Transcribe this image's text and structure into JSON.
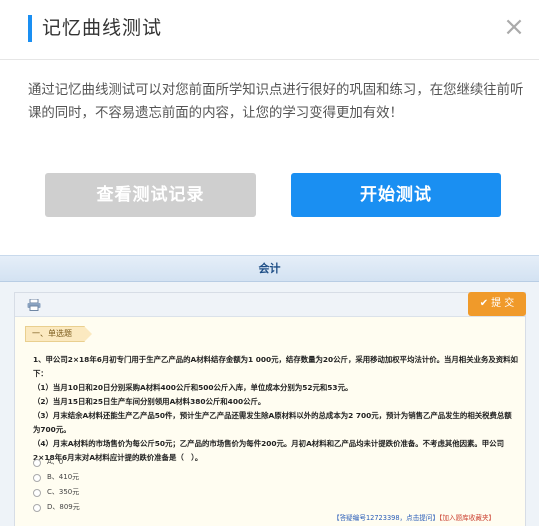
{
  "dialog": {
    "title": "记忆曲线测试",
    "close_symbol": "×",
    "intro": "通过记忆曲线测试可以对您前面所学知识点进行很好的巩固和练习，在您继续往前听课的同时，不容易遗忘前面的内容，让您的学习变得更加有效！",
    "records_button": "查看测试记录",
    "start_button": "开始测试"
  },
  "colors": {
    "accent": "#1a8ff2",
    "disabled_button": "#cfcfcf",
    "submit_orange": "#f09a2a"
  },
  "preview": {
    "bar_title": "会计",
    "submit_label": "提 交",
    "section": "一、单选题",
    "question_lines": [
      "1、甲公司2×18年6月初专门用于生产乙产品的A材料结存金额为1 000元，结存数量为20公斤，采用移动加权平均法计价。当月相关业务及资料如下：",
      "（1）当月10日和20日分别采购A材料400公斤和500公斤入库，单位成本分别为52元和53元。",
      "（2）当月15日和25日生产车间分别领用A材料380公斤和400公斤。",
      "（3）月末结余A材料还能生产乙产品50件，预计生产乙产品还需发生除A原材料以外的总成本为2 700元，预计为销售乙产品发生的相关税费总额为700元。",
      "（4）月末A材料的市场售价为每公斤50元；乙产品的市场售价为每件200元。月初A材料和乙产品均未计提跌价准备。不考虑其他因素。甲公司2×18年6月末对A材料应计提的跌价准备是（　）。"
    ],
    "options": [
      "A、0",
      "B、410元",
      "C、350元",
      "D、809元"
    ],
    "link_code": "【答疑编号12723398，点击提问】",
    "link_add": "【加入题库收藏夹】"
  }
}
